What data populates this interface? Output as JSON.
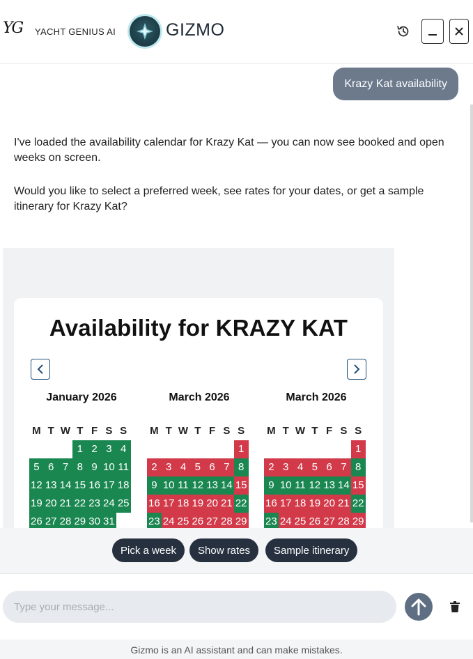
{
  "header": {
    "logo_mark": "YG",
    "brand": "YACHT GENIUS AI",
    "assistant_name": "GIZMO",
    "icons": [
      "history-icon",
      "minimize-icon",
      "close-icon"
    ]
  },
  "chat": {
    "user_message": "Krazy Kat availability",
    "bot_messages": [
      "I've loaded the availability calendar for Krazy Kat — you can now see booked and open weeks on screen.",
      "Would you like to select a preferred week, see rates for your dates, or get a sample itinerary for Krazy Kat?"
    ]
  },
  "calendar": {
    "title": "Availability for KRAZY KAT",
    "colors": {
      "available": "#1a8751",
      "booked": "#d23a4a"
    },
    "weekday_headers": [
      "M",
      "T",
      "W",
      "T",
      "F",
      "S",
      "S"
    ],
    "months": [
      {
        "name": "January 2026",
        "offset": 3,
        "days": [
          {
            "d": "1",
            "s": "g"
          },
          {
            "d": "2",
            "s": "g"
          },
          {
            "d": "3",
            "s": "g"
          },
          {
            "d": "4",
            "s": "g"
          },
          {
            "d": "5",
            "s": "g"
          },
          {
            "d": "6",
            "s": "g"
          },
          {
            "d": "7",
            "s": "g"
          },
          {
            "d": "8",
            "s": "g"
          },
          {
            "d": "9",
            "s": "g"
          },
          {
            "d": "10",
            "s": "g"
          },
          {
            "d": "11",
            "s": "g"
          },
          {
            "d": "12",
            "s": "g"
          },
          {
            "d": "13",
            "s": "g"
          },
          {
            "d": "14",
            "s": "g"
          },
          {
            "d": "15",
            "s": "g"
          },
          {
            "d": "16",
            "s": "g"
          },
          {
            "d": "17",
            "s": "g"
          },
          {
            "d": "18",
            "s": "g"
          },
          {
            "d": "19",
            "s": "g"
          },
          {
            "d": "20",
            "s": "g"
          },
          {
            "d": "21",
            "s": "g"
          },
          {
            "d": "22",
            "s": "g"
          },
          {
            "d": "23",
            "s": "g"
          },
          {
            "d": "24",
            "s": "g"
          },
          {
            "d": "25",
            "s": "g"
          },
          {
            "d": "26",
            "s": "g"
          },
          {
            "d": "27",
            "s": "g"
          },
          {
            "d": "28",
            "s": "g"
          },
          {
            "d": "29",
            "s": "g"
          },
          {
            "d": "30",
            "s": "g"
          },
          {
            "d": "31",
            "s": "g"
          }
        ]
      },
      {
        "name": "March 2026",
        "offset": 6,
        "days": [
          {
            "d": "1",
            "s": "r"
          },
          {
            "d": "2",
            "s": "r"
          },
          {
            "d": "3",
            "s": "r"
          },
          {
            "d": "4",
            "s": "r"
          },
          {
            "d": "5",
            "s": "r"
          },
          {
            "d": "6",
            "s": "r"
          },
          {
            "d": "7",
            "s": "r"
          },
          {
            "d": "8",
            "s": "g"
          },
          {
            "d": "9",
            "s": "g"
          },
          {
            "d": "10",
            "s": "g"
          },
          {
            "d": "11",
            "s": "g"
          },
          {
            "d": "12",
            "s": "g"
          },
          {
            "d": "13",
            "s": "g"
          },
          {
            "d": "14",
            "s": "g"
          },
          {
            "d": "15",
            "s": "r"
          },
          {
            "d": "16",
            "s": "r"
          },
          {
            "d": "17",
            "s": "r"
          },
          {
            "d": "18",
            "s": "r"
          },
          {
            "d": "19",
            "s": "r"
          },
          {
            "d": "20",
            "s": "r"
          },
          {
            "d": "21",
            "s": "r"
          },
          {
            "d": "22",
            "s": "g"
          },
          {
            "d": "23",
            "s": "g"
          },
          {
            "d": "24",
            "s": "r"
          },
          {
            "d": "25",
            "s": "r"
          },
          {
            "d": "26",
            "s": "r"
          },
          {
            "d": "27",
            "s": "r"
          },
          {
            "d": "28",
            "s": "r"
          },
          {
            "d": "29",
            "s": "r"
          }
        ]
      },
      {
        "name": "March 2026",
        "offset": 6,
        "days": [
          {
            "d": "1",
            "s": "r"
          },
          {
            "d": "2",
            "s": "r"
          },
          {
            "d": "3",
            "s": "r"
          },
          {
            "d": "4",
            "s": "r"
          },
          {
            "d": "5",
            "s": "r"
          },
          {
            "d": "6",
            "s": "r"
          },
          {
            "d": "7",
            "s": "r"
          },
          {
            "d": "8",
            "s": "g"
          },
          {
            "d": "9",
            "s": "g"
          },
          {
            "d": "10",
            "s": "g"
          },
          {
            "d": "11",
            "s": "g"
          },
          {
            "d": "12",
            "s": "g"
          },
          {
            "d": "13",
            "s": "g"
          },
          {
            "d": "14",
            "s": "g"
          },
          {
            "d": "15",
            "s": "r"
          },
          {
            "d": "16",
            "s": "r"
          },
          {
            "d": "17",
            "s": "r"
          },
          {
            "d": "18",
            "s": "r"
          },
          {
            "d": "19",
            "s": "r"
          },
          {
            "d": "20",
            "s": "r"
          },
          {
            "d": "21",
            "s": "r"
          },
          {
            "d": "22",
            "s": "g"
          },
          {
            "d": "23",
            "s": "g"
          },
          {
            "d": "24",
            "s": "r"
          },
          {
            "d": "25",
            "s": "r"
          },
          {
            "d": "26",
            "s": "r"
          },
          {
            "d": "27",
            "s": "r"
          },
          {
            "d": "28",
            "s": "r"
          },
          {
            "d": "29",
            "s": "r"
          }
        ]
      }
    ]
  },
  "quick_replies": [
    "Pick a week",
    "Show rates",
    "Sample itinerary"
  ],
  "input": {
    "placeholder": "Type your message..."
  },
  "footer": {
    "disclaimer": "Gizmo is an AI assistant and can make mistakes."
  }
}
